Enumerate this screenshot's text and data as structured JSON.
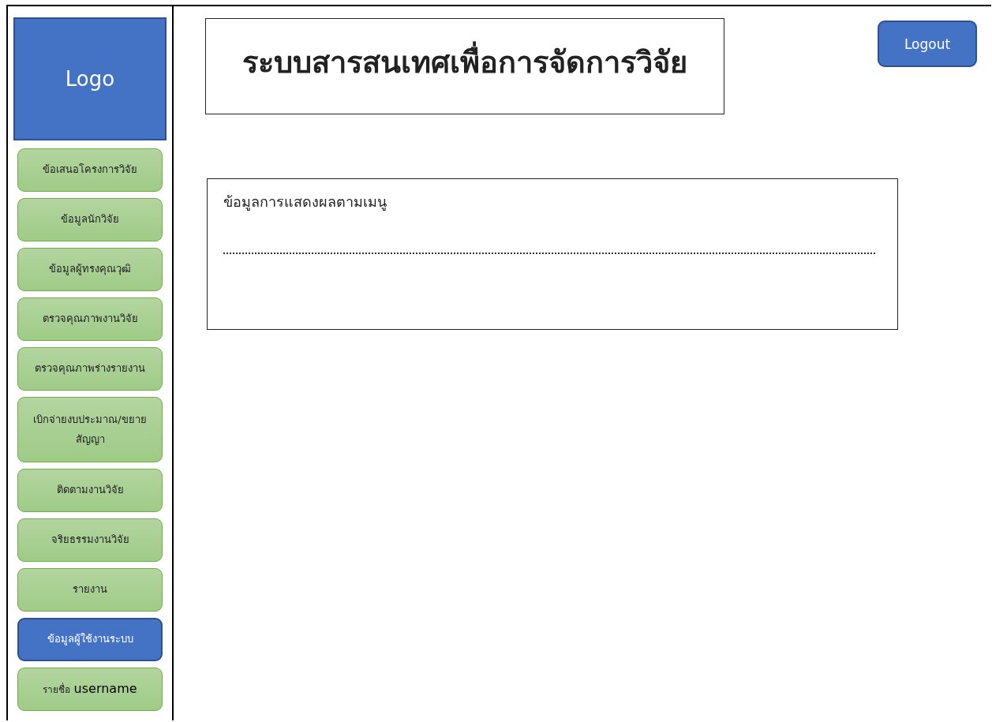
{
  "logo": {
    "text": "Logo"
  },
  "title": "ระบบสารสนเทศเพื่อการจัดการวิจัย",
  "logout": "Logout",
  "menu": [
    {
      "kind": "item",
      "label": "ข้อเสนอโครงการวิจัย",
      "selected": false
    },
    {
      "kind": "item",
      "label": "ข้อมูลนักวิจัย",
      "selected": false
    },
    {
      "kind": "item",
      "label": "ข้อมูลผู้ทรงคุณวุฒิ",
      "selected": false
    },
    {
      "kind": "item",
      "label": "ตรวจคุณภาพงานวิจัย",
      "selected": false
    },
    {
      "kind": "item",
      "label": "ตรวจคุณภาพร่างรายงาน",
      "selected": false
    },
    {
      "kind": "item",
      "label": "เบิกจ่ายงบประมาณ/ขยายสัญญา",
      "selected": false
    },
    {
      "kind": "item",
      "label": "ติดตามงานวิจัย",
      "selected": false
    },
    {
      "kind": "item",
      "label": "จริยธรรมงานวิจัย",
      "selected": false
    },
    {
      "kind": "item",
      "label": "รายงาน",
      "selected": false
    },
    {
      "kind": "item",
      "label": "ข้อมูลผู้ใช้งานระบบ",
      "selected": true
    },
    {
      "kind": "user",
      "label": "รายชื่อ",
      "value": "username",
      "selected": false
    }
  ],
  "content": {
    "heading": "ข้อมูลการแสดงผลตามเมนู"
  }
}
